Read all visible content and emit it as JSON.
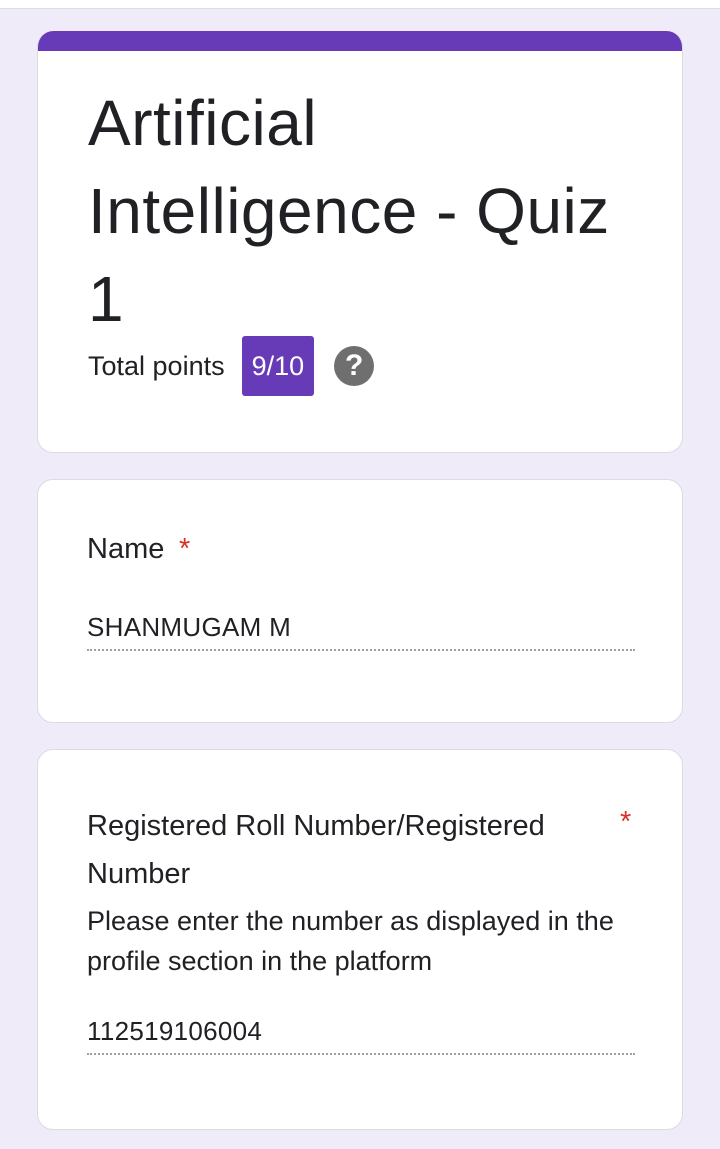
{
  "form": {
    "title": "Artificial Intelligence - Quiz 1",
    "total_points_label": "Total points",
    "score": "9/10",
    "help_glyph": "?",
    "accent_color": "#673ab7",
    "background_color": "#f0ebf8"
  },
  "questions": [
    {
      "title": "Name",
      "required_marker": "*",
      "answer": "SHANMUGAM M"
    },
    {
      "title": "Registered Roll Number/Registered Number",
      "required_marker": "*",
      "description": "Please enter the number as displayed in the profile section in the platform",
      "answer": "112519106004"
    }
  ]
}
